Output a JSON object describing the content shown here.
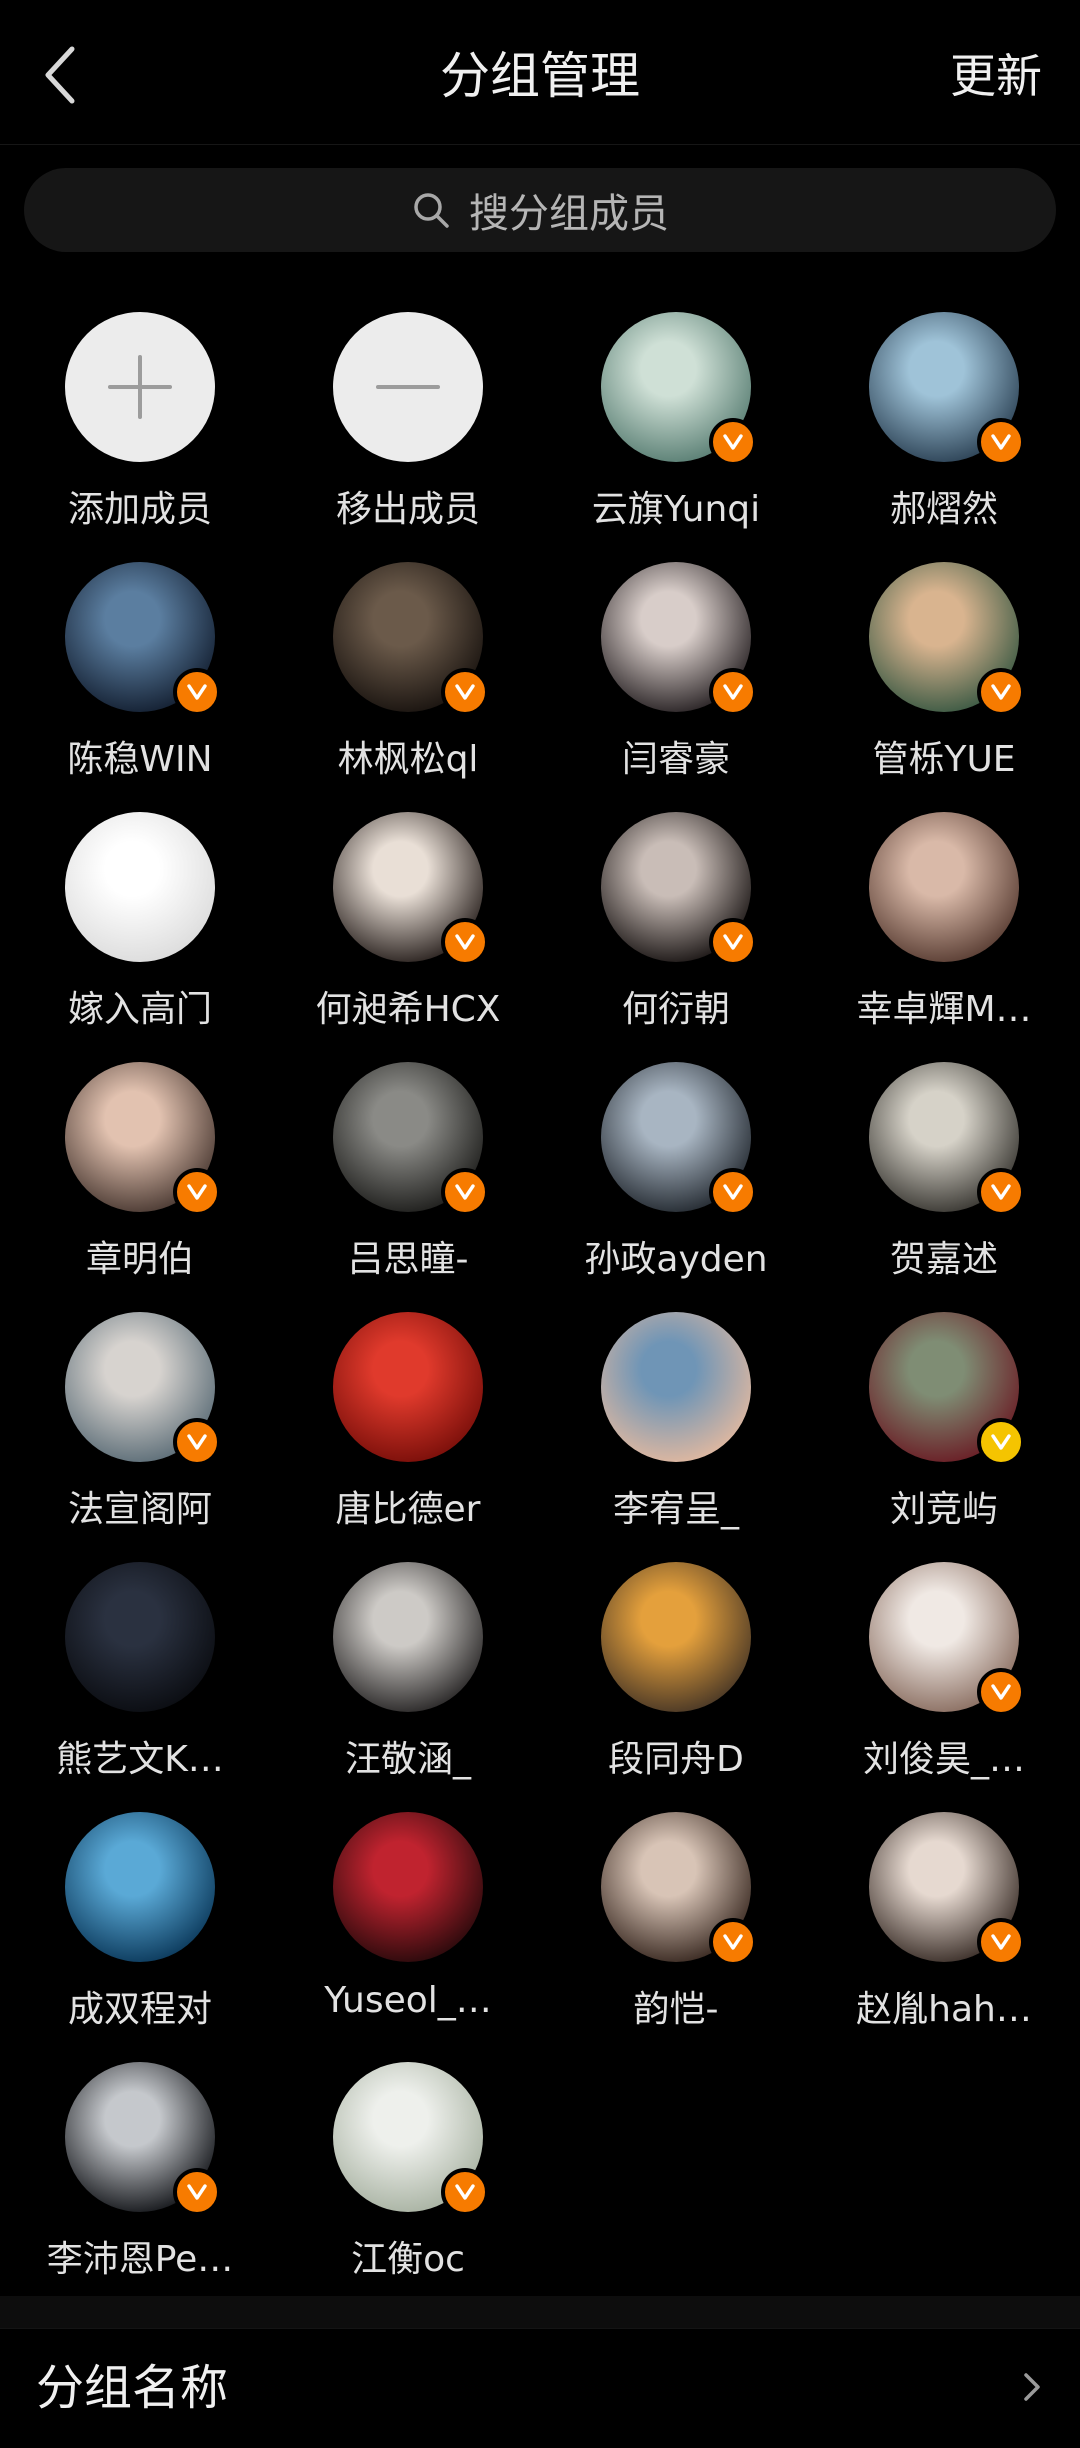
{
  "header": {
    "title": "分组管理",
    "update_label": "更新"
  },
  "search": {
    "placeholder": "搜分组成员"
  },
  "actions": [
    {
      "label": "添加成员",
      "icon": "plus-icon"
    },
    {
      "label": "移出成员",
      "icon": "minus-icon"
    }
  ],
  "members": [
    {
      "name": "云旗Yunqi",
      "verified": true,
      "badge_color": "#f77b00",
      "avatar_colors": [
        "#cfe0d6",
        "#5a7f74"
      ]
    },
    {
      "name": "郝熠然",
      "verified": true,
      "badge_color": "#f77b00",
      "avatar_colors": [
        "#9fc3d8",
        "#2d4356"
      ]
    },
    {
      "name": "陈稳WIN",
      "verified": true,
      "badge_color": "#f77b00",
      "avatar_colors": [
        "#5b7ea0",
        "#142032"
      ]
    },
    {
      "name": "林枫松ql",
      "verified": true,
      "badge_color": "#f77b00",
      "avatar_colors": [
        "#6b5a4a",
        "#1a1410"
      ]
    },
    {
      "name": "闫睿豪",
      "verified": true,
      "badge_color": "#f77b00",
      "avatar_colors": [
        "#d8cdc9",
        "#2a2426"
      ]
    },
    {
      "name": "管栎YUE",
      "verified": true,
      "badge_color": "#f77b00",
      "avatar_colors": [
        "#d9b48f",
        "#3c5a44"
      ]
    },
    {
      "name": "嫁入高门",
      "verified": false,
      "badge_color": "",
      "avatar_colors": [
        "#ffffff",
        "#dcdcdc"
      ]
    },
    {
      "name": "何昶希HCX",
      "verified": true,
      "badge_color": "#f77b00",
      "avatar_colors": [
        "#e9dfd6",
        "#2b2320"
      ]
    },
    {
      "name": "何衍朝",
      "verified": true,
      "badge_color": "#f77b00",
      "avatar_colors": [
        "#c9bdb7",
        "#1c1716"
      ]
    },
    {
      "name": "幸卓輝M…",
      "verified": false,
      "badge_color": "",
      "avatar_colors": [
        "#d9b9a8",
        "#5a3e34"
      ]
    },
    {
      "name": "章明伯",
      "verified": true,
      "badge_color": "#f77b00",
      "avatar_colors": [
        "#e2c2b0",
        "#4b3a33"
      ]
    },
    {
      "name": "吕思瞳-",
      "verified": true,
      "badge_color": "#f77b00",
      "avatar_colors": [
        "#8a8a86",
        "#1f1f1d"
      ]
    },
    {
      "name": "孙政ayden",
      "verified": true,
      "badge_color": "#f77b00",
      "avatar_colors": [
        "#a8b5c2",
        "#252b32"
      ]
    },
    {
      "name": "贺嘉述",
      "verified": true,
      "badge_color": "#f77b00",
      "avatar_colors": [
        "#d6d2c8",
        "#3a3833"
      ]
    },
    {
      "name": "法宣阁阿",
      "verified": true,
      "badge_color": "#f77b00",
      "avatar_colors": [
        "#d7d3cf",
        "#5d6e78"
      ]
    },
    {
      "name": "唐比德er",
      "verified": false,
      "badge_color": "",
      "avatar_colors": [
        "#e03a2c",
        "#7a0f0a"
      ]
    },
    {
      "name": "李宥呈_",
      "verified": false,
      "badge_color": "",
      "avatar_colors": [
        "#6f95b6",
        "#e0b8a0"
      ]
    },
    {
      "name": "刘竞屿",
      "verified": true,
      "badge_color": "#f5c400",
      "avatar_colors": [
        "#7f8d74",
        "#6a1e26"
      ]
    },
    {
      "name": "熊艺文K…",
      "verified": false,
      "badge_color": "",
      "avatar_colors": [
        "#2a3140",
        "#0b0d12"
      ]
    },
    {
      "name": "汪敬涵_",
      "verified": false,
      "badge_color": "",
      "avatar_colors": [
        "#cdcac6",
        "#2a2828"
      ]
    },
    {
      "name": "段同舟D",
      "verified": false,
      "badge_color": "",
      "avatar_colors": [
        "#e4a03c",
        "#4a3826"
      ]
    },
    {
      "name": "刘俊昊_…",
      "verified": true,
      "badge_color": "#f77b00",
      "avatar_colors": [
        "#f0e9e4",
        "#8b6f62"
      ]
    },
    {
      "name": "成双程对",
      "verified": false,
      "badge_color": "",
      "avatar_colors": [
        "#5aa9d6",
        "#0c3a5c"
      ]
    },
    {
      "name": "Yuseol_…",
      "verified": false,
      "badge_color": "",
      "avatar_colors": [
        "#c0232f",
        "#2a0a0c"
      ]
    },
    {
      "name": "韵恺-",
      "verified": true,
      "badge_color": "#f77b00",
      "avatar_colors": [
        "#d8c4b6",
        "#3a2a22"
      ]
    },
    {
      "name": "赵胤hah…",
      "verified": true,
      "badge_color": "#f77b00",
      "avatar_colors": [
        "#e6d9d0",
        "#3c302a"
      ]
    },
    {
      "name": "李沛恩Pe…",
      "verified": true,
      "badge_color": "#f77b00",
      "avatar_colors": [
        "#c5c8cc",
        "#16181c"
      ]
    },
    {
      "name": "江衡oc",
      "verified": true,
      "badge_color": "#f77b00",
      "avatar_colors": [
        "#eef0ec",
        "#a9b3a3"
      ]
    }
  ],
  "footer": {
    "group_name_label": "分组名称"
  }
}
